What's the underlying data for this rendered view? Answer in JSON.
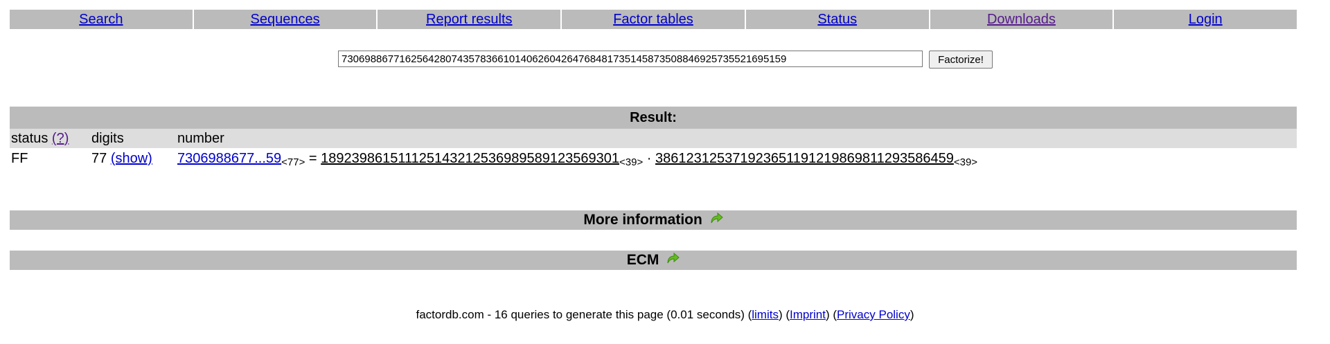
{
  "nav": {
    "items": [
      {
        "label": "Search"
      },
      {
        "label": "Sequences"
      },
      {
        "label": "Report results"
      },
      {
        "label": "Factor tables"
      },
      {
        "label": "Status"
      },
      {
        "label": "Downloads"
      },
      {
        "label": "Login"
      }
    ]
  },
  "search": {
    "value": "73069886771625642807435783661014062604264768481735145873508846925735521695159",
    "button_label": "Factorize!"
  },
  "result": {
    "title": "Result:",
    "columns": {
      "status": "status",
      "status_help": "(?)",
      "digits": "digits",
      "number": "number"
    },
    "row": {
      "status": "FF",
      "digits": "77",
      "show_link": "(show)",
      "number_link": "7306988677...59",
      "number_sub": "<77>",
      "equals": " = ",
      "factor1": "18923986151112514321253698958912356930 1",
      "factor1_sub": "<39>",
      "dot": " · ",
      "factor2": "386123125371923651191219869811293586459",
      "factor2_sub": "<39>"
    }
  },
  "sections": {
    "more_info": "More information",
    "ecm": "ECM"
  },
  "footer": {
    "text": "factordb.com - 16 queries to generate this page (0.01 seconds) (",
    "limits": "limits",
    "sep1": ") (",
    "imprint": "Imprint",
    "sep2": ") (",
    "privacy": "Privacy Policy",
    "end": ")"
  },
  "colors": {
    "bar": "#bbbbbb",
    "subheader": "#dddddd",
    "link": "#0000cc",
    "visited": "#551a8b",
    "arrow": "#66bb22"
  }
}
